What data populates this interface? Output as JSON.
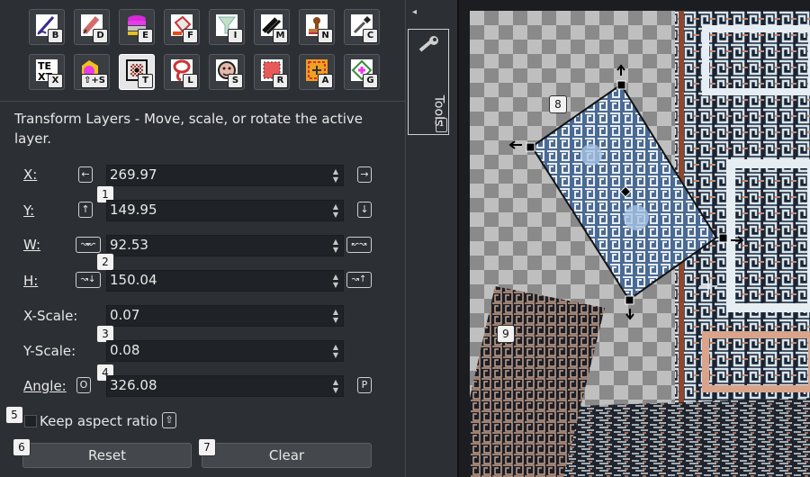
{
  "tools": {
    "row1": [
      {
        "name": "brush-tool",
        "key": "B"
      },
      {
        "name": "eraser-tool",
        "key": "D"
      },
      {
        "name": "layers-stack-tool",
        "key": "E"
      },
      {
        "name": "fill-tool",
        "key": "F"
      },
      {
        "name": "filter-tool",
        "key": "I"
      },
      {
        "name": "smudge-tool",
        "key": "M"
      },
      {
        "name": "stamp-tool",
        "key": "N"
      },
      {
        "name": "color-picker-tool",
        "key": "C"
      }
    ],
    "row2": [
      {
        "name": "text-tool",
        "key": "X"
      },
      {
        "name": "shape-tool",
        "key": "⇧+S"
      },
      {
        "name": "transform-tool",
        "key": "T"
      },
      {
        "name": "lasso-tool",
        "key": "L"
      },
      {
        "name": "selection-tool",
        "key": "S"
      },
      {
        "name": "rect-select-tool",
        "key": "R"
      },
      {
        "name": "auto-select-tool",
        "key": "A"
      },
      {
        "name": "gradient-tool",
        "key": "G"
      }
    ]
  },
  "tool_description": "Transform Layers - Move, scale, or rotate the active layer.",
  "fields": {
    "x": {
      "label": "X:",
      "value": "269.97",
      "left_btn": "←",
      "right_btn": "→"
    },
    "y": {
      "label": "Y:",
      "value": "149.95",
      "left_btn": "↑",
      "right_btn": "↓"
    },
    "w": {
      "label": "W:",
      "value": "92.53",
      "left_btn": "↝↜",
      "right_btn": "↜↝"
    },
    "h": {
      "label": "H:",
      "value": "150.04",
      "left_btn": "↝↓",
      "right_btn": "↝↑"
    },
    "xscale": {
      "label": "X-Scale:",
      "value": "0.07"
    },
    "yscale": {
      "label": "Y-Scale:",
      "value": "0.08"
    },
    "angle": {
      "label": "Angle:",
      "value": "326.08",
      "left_btn": "O",
      "right_btn": "P"
    }
  },
  "badges": [
    "1",
    "2",
    "3",
    "4",
    "5",
    "6",
    "7",
    "8",
    "9"
  ],
  "keep_aspect": {
    "label": "Keep aspect ratio",
    "key": "⇧"
  },
  "buttons": {
    "reset": "Reset",
    "clear": "Clear"
  },
  "side_tab": {
    "label": "Tools",
    "key": "1",
    "collapse": "◂"
  }
}
